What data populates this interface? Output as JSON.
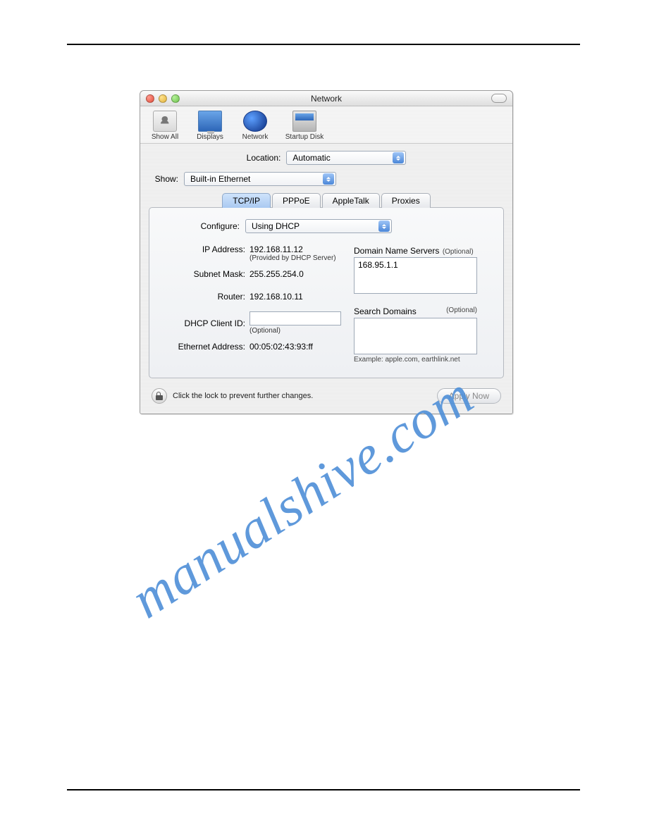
{
  "window": {
    "title": "Network"
  },
  "toolbar": {
    "show_all": "Show All",
    "displays": "Displays",
    "network": "Network",
    "startup_disk": "Startup Disk"
  },
  "location": {
    "label": "Location:",
    "value": "Automatic"
  },
  "show": {
    "label": "Show:",
    "value": "Built-in Ethernet"
  },
  "tabs": {
    "tcpip": "TCP/IP",
    "pppoe": "PPPoE",
    "appletalk": "AppleTalk",
    "proxies": "Proxies"
  },
  "configure": {
    "label": "Configure:",
    "value": "Using DHCP"
  },
  "ip": {
    "label": "IP Address:",
    "value": "192.168.11.12",
    "note": "(Provided by DHCP Server)"
  },
  "subnet": {
    "label": "Subnet Mask:",
    "value": "255.255.254.0"
  },
  "router": {
    "label": "Router:",
    "value": "192.168.10.11"
  },
  "dhcp_client": {
    "label": "DHCP Client ID:",
    "value": "",
    "note": "(Optional)"
  },
  "ethernet_addr": {
    "label": "Ethernet Address:",
    "value": "00:05:02:43:93:ff"
  },
  "dns": {
    "label": "Domain Name Servers",
    "optional": "(Optional)",
    "value": "168.95.1.1"
  },
  "search": {
    "label": "Search Domains",
    "optional": "(Optional)",
    "value": "",
    "example": "Example: apple.com, earthlink.net"
  },
  "footer": {
    "lock_text": "Click the lock to prevent further changes.",
    "apply": "Apply Now"
  },
  "watermark": "manualshive.com"
}
